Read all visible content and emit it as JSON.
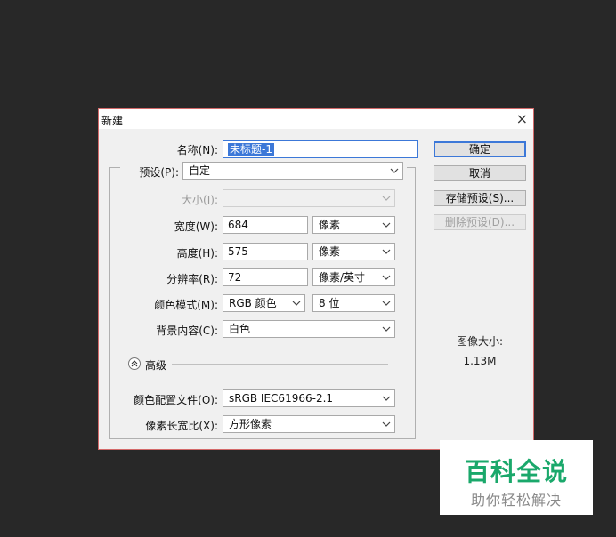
{
  "dialog": {
    "title": "新建",
    "close_glyph": "×",
    "fields": {
      "name_label": "名称(N):",
      "name_value": "未标题-1",
      "preset_label": "预设(P):",
      "preset_value": "自定",
      "size_label": "大小(I):",
      "size_value": "",
      "width_label": "宽度(W):",
      "width_value": "684",
      "width_unit": "像素",
      "height_label": "高度(H):",
      "height_value": "575",
      "height_unit": "像素",
      "resolution_label": "分辨率(R):",
      "resolution_value": "72",
      "resolution_unit": "像素/英寸",
      "color_mode_label": "颜色模式(M):",
      "color_mode_value": "RGB 颜色",
      "bit_depth_value": "8 位",
      "background_label": "背景内容(C):",
      "background_value": "白色",
      "advanced_label": "高级",
      "color_profile_label": "颜色配置文件(O):",
      "color_profile_value": "sRGB IEC61966-2.1",
      "pixel_aspect_label": "像素长宽比(X):",
      "pixel_aspect_value": "方形像素"
    },
    "buttons": {
      "ok": "确定",
      "cancel": "取消",
      "save_preset": "存储预设(S)...",
      "delete_preset": "删除预设(D)..."
    },
    "image_size_label": "图像大小:",
    "image_size_value": "1.13M"
  },
  "watermark": {
    "title": "百科全说",
    "subtitle": "助你轻松解决"
  }
}
